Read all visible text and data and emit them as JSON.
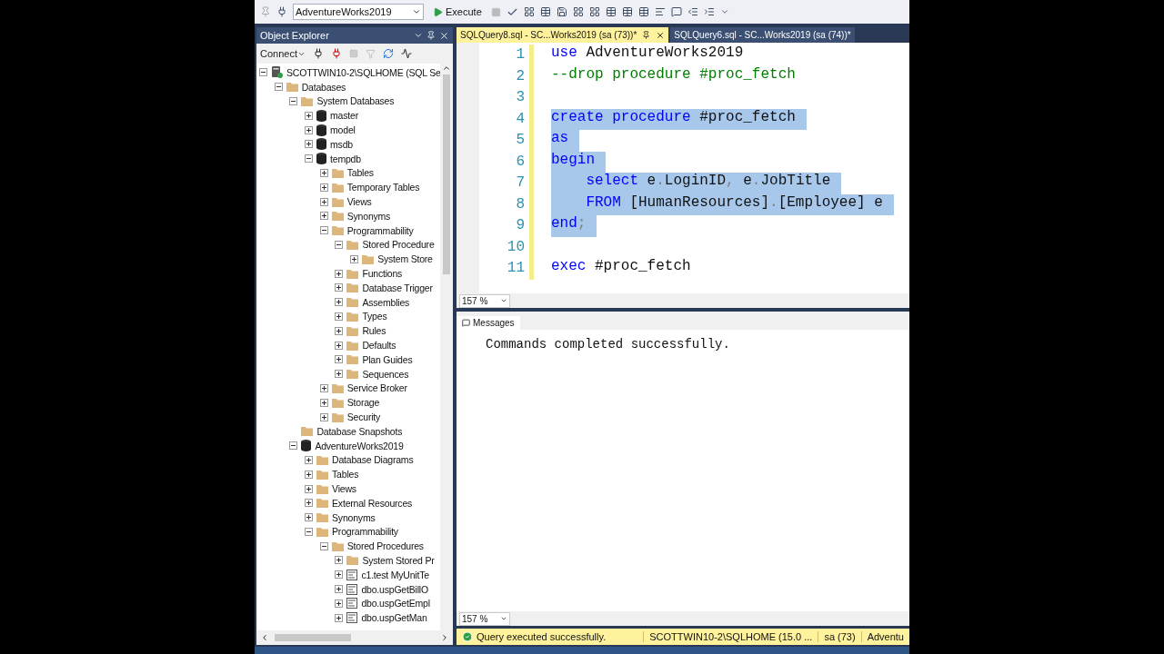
{
  "toolbar": {
    "database": "AdventureWorks2019",
    "execute": "Execute"
  },
  "object_explorer": {
    "title": "Object Explorer",
    "connect": "Connect",
    "tree": [
      {
        "label": "SCOTTWIN10-2\\SQLHOME (SQL Se",
        "kind": "server",
        "expanded": true,
        "children": [
          {
            "label": "Databases",
            "kind": "folder",
            "expanded": true,
            "children": [
              {
                "label": "System Databases",
                "kind": "folder",
                "expanded": true,
                "children": [
                  {
                    "label": "master",
                    "kind": "database",
                    "expanded": false
                  },
                  {
                    "label": "model",
                    "kind": "database",
                    "expanded": false
                  },
                  {
                    "label": "msdb",
                    "kind": "database",
                    "expanded": false
                  },
                  {
                    "label": "tempdb",
                    "kind": "database",
                    "expanded": true,
                    "children": [
                      {
                        "label": "Tables",
                        "kind": "folder",
                        "expanded": false
                      },
                      {
                        "label": "Temporary Tables",
                        "kind": "folder",
                        "expanded": false
                      },
                      {
                        "label": "Views",
                        "kind": "folder",
                        "expanded": false
                      },
                      {
                        "label": "Synonyms",
                        "kind": "folder",
                        "expanded": false
                      },
                      {
                        "label": "Programmability",
                        "kind": "folder",
                        "expanded": true,
                        "children": [
                          {
                            "label": "Stored Procedure",
                            "kind": "folder",
                            "expanded": true,
                            "children": [
                              {
                                "label": "System Store",
                                "kind": "folder",
                                "expanded": false
                              }
                            ]
                          },
                          {
                            "label": "Functions",
                            "kind": "folder",
                            "expanded": false
                          },
                          {
                            "label": "Database Trigger",
                            "kind": "folder",
                            "expanded": false
                          },
                          {
                            "label": "Assemblies",
                            "kind": "folder",
                            "expanded": false
                          },
                          {
                            "label": "Types",
                            "kind": "folder",
                            "expanded": false
                          },
                          {
                            "label": "Rules",
                            "kind": "folder",
                            "expanded": false
                          },
                          {
                            "label": "Defaults",
                            "kind": "folder",
                            "expanded": false
                          },
                          {
                            "label": "Plan Guides",
                            "kind": "folder",
                            "expanded": false
                          },
                          {
                            "label": "Sequences",
                            "kind": "folder",
                            "expanded": false
                          }
                        ]
                      },
                      {
                        "label": "Service Broker",
                        "kind": "folder",
                        "expanded": false
                      },
                      {
                        "label": "Storage",
                        "kind": "folder",
                        "expanded": false
                      },
                      {
                        "label": "Security",
                        "kind": "folder",
                        "expanded": false
                      }
                    ]
                  }
                ]
              },
              {
                "label": "Database Snapshots",
                "kind": "folder"
              },
              {
                "label": "AdventureWorks2019",
                "kind": "database",
                "expanded": true,
                "children": [
                  {
                    "label": "Database Diagrams",
                    "kind": "folder",
                    "expanded": false
                  },
                  {
                    "label": "Tables",
                    "kind": "folder",
                    "expanded": false
                  },
                  {
                    "label": "Views",
                    "kind": "folder",
                    "expanded": false
                  },
                  {
                    "label": "External Resources",
                    "kind": "folder",
                    "expanded": false
                  },
                  {
                    "label": "Synonyms",
                    "kind": "folder",
                    "expanded": false
                  },
                  {
                    "label": "Programmability",
                    "kind": "folder",
                    "expanded": true,
                    "children": [
                      {
                        "label": "Stored Procedures",
                        "kind": "folder",
                        "expanded": true,
                        "children": [
                          {
                            "label": "System Stored Pr",
                            "kind": "folder",
                            "expanded": false
                          },
                          {
                            "label": "c1.test MyUnitTe",
                            "kind": "procedure",
                            "expanded": false
                          },
                          {
                            "label": "dbo.uspGetBillO",
                            "kind": "procedure",
                            "expanded": false
                          },
                          {
                            "label": "dbo.uspGetEmpl",
                            "kind": "procedure",
                            "expanded": false
                          },
                          {
                            "label": "dbo.uspGetMan",
                            "kind": "procedure",
                            "expanded": false
                          }
                        ]
                      }
                    ]
                  }
                ]
              }
            ]
          }
        ]
      }
    ]
  },
  "tabs": [
    {
      "label": "SQLQuery8.sql - SC...Works2019 (sa (73))*",
      "selected": true
    },
    {
      "label": "SQLQuery6.sql - SC...Works2019 (sa (74))*",
      "selected": false
    }
  ],
  "editor": {
    "lines": [
      {
        "number": "1",
        "selected": false,
        "tokens": [
          {
            "text": "use",
            "kind": "keyword"
          },
          {
            "text": " AdventureWorks2019",
            "kind": "plain"
          }
        ]
      },
      {
        "number": "2",
        "selected": false,
        "tokens": [
          {
            "text": "--drop procedure #proc_fetch",
            "kind": "comment"
          }
        ]
      },
      {
        "number": "3",
        "selected": false
      },
      {
        "number": "4",
        "selected": true,
        "tokens": [
          {
            "text": "create procedure",
            "kind": "keyword"
          },
          {
            "text": " #proc_fetch",
            "kind": "plain"
          }
        ]
      },
      {
        "number": "5",
        "selected": true,
        "tokens": [
          {
            "text": "as",
            "kind": "keyword"
          }
        ]
      },
      {
        "number": "6",
        "selected": true,
        "tokens": [
          {
            "text": "begin",
            "kind": "keyword"
          }
        ]
      },
      {
        "number": "7",
        "selected": true,
        "tokens": [
          {
            "text": "    select",
            "kind": "keyword"
          },
          {
            "text": " e",
            "kind": "plain"
          },
          {
            "text": ".",
            "kind": "operator"
          },
          {
            "text": "LoginID",
            "kind": "plain"
          },
          {
            "text": ",",
            "kind": "operator"
          },
          {
            "text": " e",
            "kind": "plain"
          },
          {
            "text": ".",
            "kind": "operator"
          },
          {
            "text": "JobTitle",
            "kind": "plain"
          }
        ]
      },
      {
        "number": "8",
        "selected": true,
        "tokens": [
          {
            "text": "    FROM",
            "kind": "keyword"
          },
          {
            "text": " [HumanResources]",
            "kind": "plain"
          },
          {
            "text": ".",
            "kind": "operator"
          },
          {
            "text": "[Employee] e",
            "kind": "plain"
          }
        ]
      },
      {
        "number": "9",
        "selected": true,
        "tokens": [
          {
            "text": "end",
            "kind": "keyword"
          },
          {
            "text": ";",
            "kind": "operator"
          }
        ]
      },
      {
        "number": "10",
        "selected": false
      },
      {
        "number": "11",
        "selected": false,
        "tokens": [
          {
            "text": "exec",
            "kind": "keyword"
          },
          {
            "text": " #proc_fetch",
            "kind": "plain"
          }
        ]
      }
    ],
    "zoom": "157 %"
  },
  "results": {
    "tab": "Messages",
    "message": "Commands completed successfully.",
    "zoom": "157 %"
  },
  "status_bar": {
    "message": "Query executed successfully.",
    "server": "SCOTTWIN10-2\\SQLHOME (15.0 ...",
    "user": "sa (73)",
    "database": "Adventu"
  }
}
